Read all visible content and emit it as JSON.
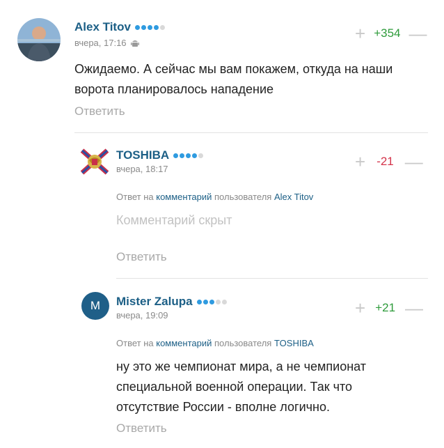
{
  "comments": [
    {
      "author": "Alex Titov",
      "rating_dots": 4,
      "time": "вчера, 17:16",
      "device_icon": "android-icon",
      "score": "+354",
      "text_lines": [
        "Ожидаемо. А сейчас мы вам покажем, откуда на наши",
        "ворота планировалось нападение"
      ],
      "reply_label": "Ответить"
    },
    {
      "author": "TOSHIBA",
      "rating_dots": 4,
      "time": "вчера, 18:17",
      "score": "-21",
      "reply_to_prefix": "Ответ на",
      "reply_to_link": "комментарий",
      "reply_to_middle": "пользователя",
      "reply_to_user": "Alex Titov",
      "hidden_text": "Комментарий скрыт",
      "reply_label": "Ответить"
    },
    {
      "author": "Mister Zalupa",
      "avatar_letter": "M",
      "rating_dots": 3,
      "time": "вчера, 19:09",
      "score": "+21",
      "reply_to_prefix": "Ответ на",
      "reply_to_link": "комментарий",
      "reply_to_middle": "пользователя",
      "reply_to_user": "TOSHIBA",
      "text_lines": [
        "ну это же чемпионат мира, а не чемпионат",
        "специальной военной операции. Так что",
        "отсутствие России - вполне логично."
      ],
      "reply_label": "Ответить"
    }
  ],
  "colors": {
    "author": "#1c5f86",
    "positive": "#2e9b3b",
    "negative": "#d4344b",
    "rating_dot": "#2f9be0",
    "avatar_m_bg": "#1f5f88"
  }
}
